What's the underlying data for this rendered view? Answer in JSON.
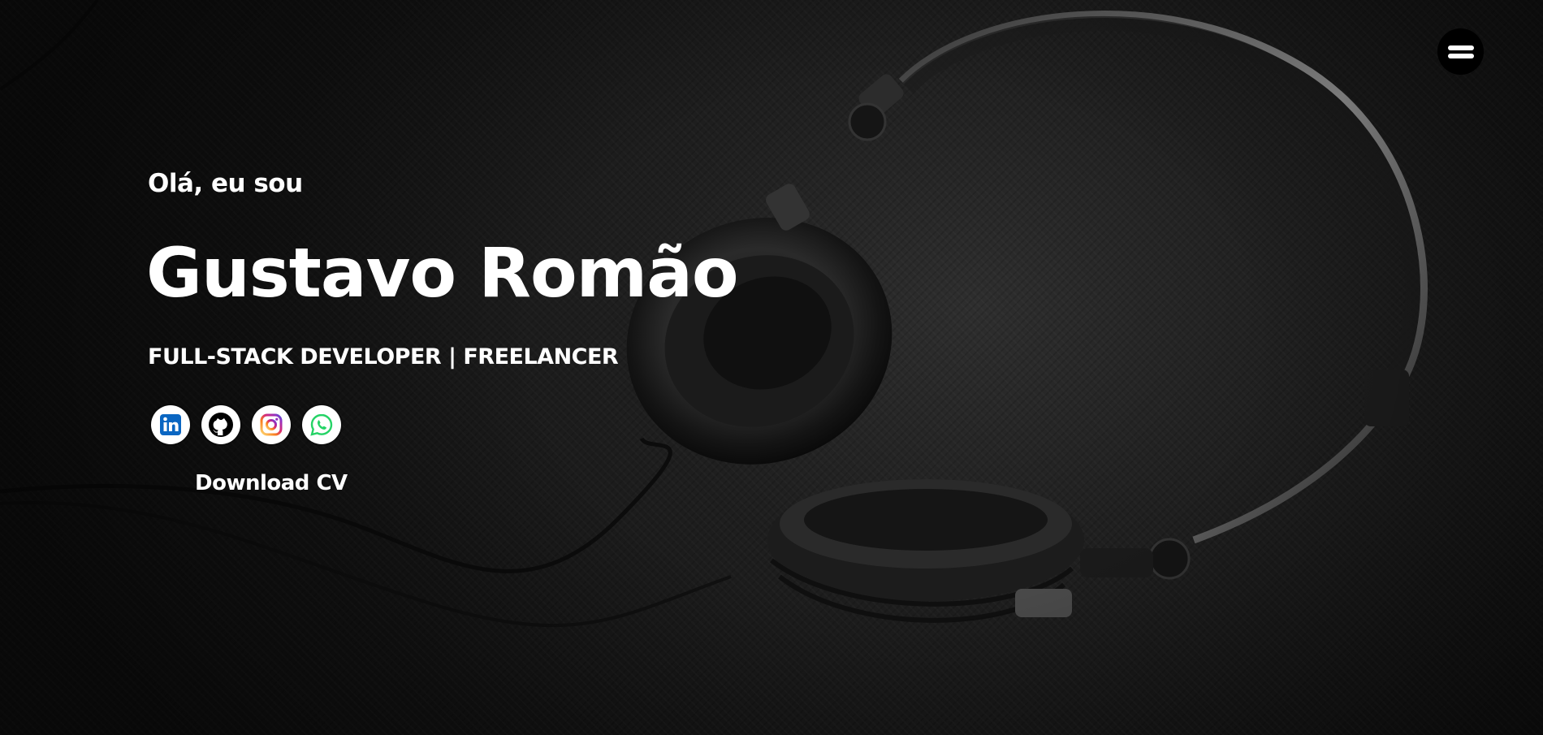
{
  "hero": {
    "greeting": "Olá, eu sou",
    "name": "Gustavo Romão",
    "role": "FULL-STACK DEVELOPER | FREELANCER",
    "download_label": "Download CV"
  },
  "menu": {
    "icon": "hamburger-menu-icon"
  },
  "socials": [
    {
      "icon": "linkedin-icon",
      "color": "#0a66c2"
    },
    {
      "icon": "github-icon",
      "color": "#000000"
    },
    {
      "icon": "instagram-icon",
      "color": "#d6249f"
    },
    {
      "icon": "whatsapp-icon",
      "color": "#25d366"
    }
  ],
  "colors": {
    "background": "#151515",
    "text": "#ffffff",
    "menu_button": "#000000"
  }
}
